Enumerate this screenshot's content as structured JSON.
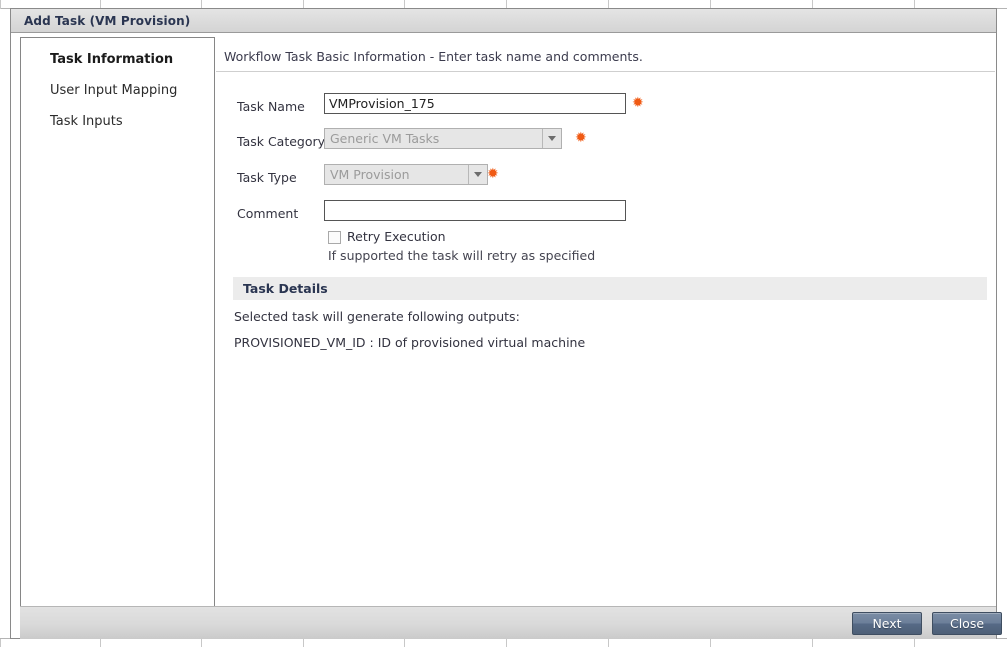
{
  "dialog": {
    "title": "Add Task (VM Provision)"
  },
  "sidebar": {
    "items": [
      {
        "label": "Task Information",
        "active": true
      },
      {
        "label": "User Input Mapping",
        "active": false
      },
      {
        "label": "Task Inputs",
        "active": false
      }
    ]
  },
  "content": {
    "header": "Workflow Task Basic Information - Enter task name and comments.",
    "required_marker": "✹",
    "fields": {
      "task_name": {
        "label": "Task Name",
        "value": "VMProvision_175",
        "placeholder": "",
        "required": true
      },
      "task_category": {
        "label": "Task Category",
        "value": "Generic VM Tasks",
        "required": true,
        "disabled": true
      },
      "task_type": {
        "label": "Task Type",
        "value": "VM Provision",
        "required": true,
        "disabled": true
      },
      "comment": {
        "label": "Comment",
        "value": "",
        "placeholder": "",
        "required": false
      }
    },
    "retry": {
      "label": "Retry Execution",
      "checked": false,
      "help": "If supported the task will retry as specified"
    },
    "details": {
      "title": "Task Details",
      "intro": "Selected task will generate following outputs:",
      "output": "PROVISIONED_VM_ID : ID of provisioned virtual machine"
    }
  },
  "footer": {
    "next_label": "Next",
    "close_label": "Close"
  },
  "colors": {
    "required_star": "#f05a14",
    "title_text": "#2a3551",
    "button_primary": "#6c7f99",
    "section_bar": "#ececec"
  }
}
